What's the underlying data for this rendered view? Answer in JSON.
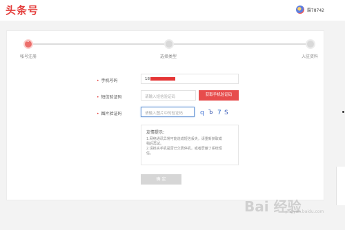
{
  "header": {
    "logo": "头条号",
    "username": "霖78742"
  },
  "steps": [
    {
      "label": "帐号注册",
      "active": true
    },
    {
      "label": "选择类型",
      "active": false
    },
    {
      "label": "入驻资料",
      "active": false
    }
  ],
  "form": {
    "phone": {
      "label": "手机号码",
      "value_prefix": "18"
    },
    "sms": {
      "label": "短信验证码",
      "placeholder": "请输入短信验证码",
      "button": "获取手机验证码"
    },
    "image_code": {
      "label": "图片验证码",
      "placeholder": "请输入图片中的验证码",
      "captcha_text": "q Ъ 7 S"
    }
  },
  "tips": {
    "title": "友情提示：",
    "items": [
      "1.网络通讯异常可能造成短信丢失，请重新获取或",
      "稍后再试。",
      "2.请核实手机是否已欠费停机，或者屏蔽了系统短",
      "信。"
    ]
  },
  "confirm_button": "确 定",
  "watermark": {
    "main": "Bai 经验",
    "sub": "jingyan.baidu.com"
  },
  "colors": {
    "brand_red": "#e43d3b",
    "button_red": "#e74c4c",
    "focus_blue": "#6a98d6"
  }
}
